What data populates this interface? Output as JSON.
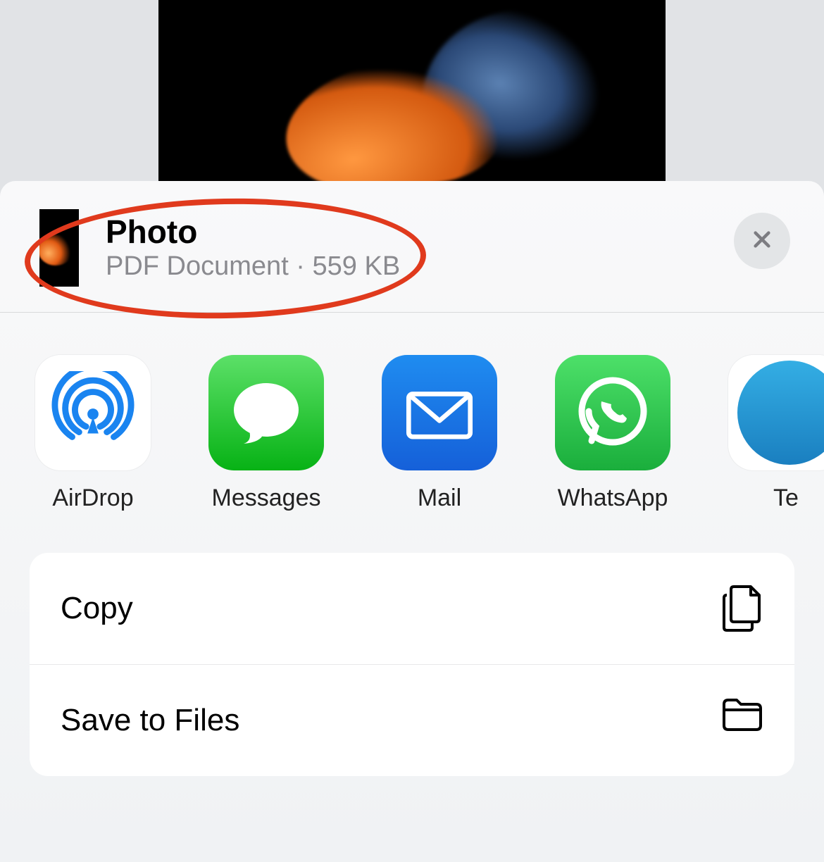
{
  "header": {
    "title": "Photo",
    "subtitle_type": "PDF Document",
    "subtitle_separator": " · ",
    "subtitle_size": "559 KB"
  },
  "apps": [
    {
      "label": "AirDrop",
      "icon": "airdrop"
    },
    {
      "label": "Messages",
      "icon": "messages"
    },
    {
      "label": "Mail",
      "icon": "mail"
    },
    {
      "label": "WhatsApp",
      "icon": "whatsapp"
    },
    {
      "label": "Te",
      "icon": "telegram"
    }
  ],
  "actions": [
    {
      "label": "Copy",
      "icon": "documents"
    },
    {
      "label": "Save to Files",
      "icon": "folder"
    }
  ],
  "annotation": {
    "type": "ellipse",
    "color": "#e03a1d"
  }
}
